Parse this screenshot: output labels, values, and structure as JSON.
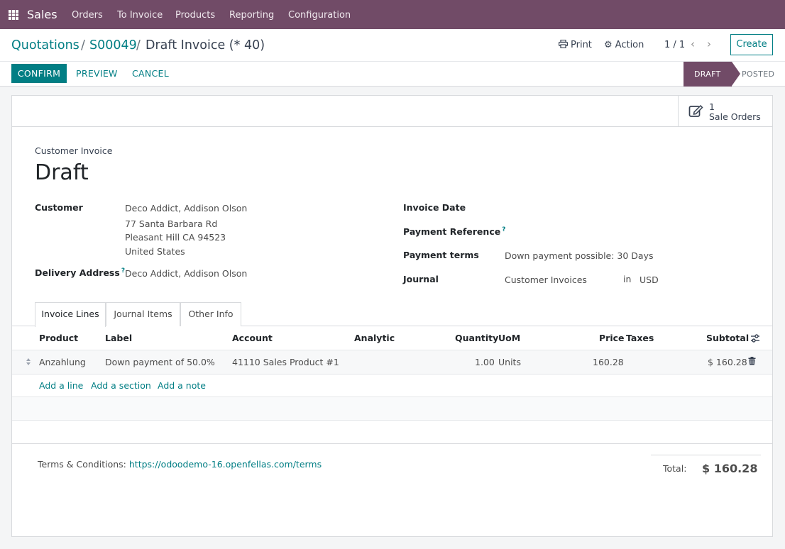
{
  "navbar": {
    "app_name": "Sales",
    "menu": [
      "Orders",
      "To Invoice",
      "Products",
      "Reporting",
      "Configuration"
    ]
  },
  "breadcrumb": {
    "items": [
      "Quotations",
      "S00049"
    ],
    "current": "Draft Invoice (* 40)",
    "separator": "/"
  },
  "control": {
    "print_label": "Print",
    "action_label": "Action",
    "pager": "1 / 1",
    "create_label": "Create"
  },
  "statusbar": {
    "buttons": [
      "CONFIRM",
      "PREVIEW",
      "CANCEL"
    ],
    "stages": [
      "DRAFT",
      "POSTED"
    ],
    "active_stage": "DRAFT"
  },
  "smart_button": {
    "count": "1",
    "label": "Sale Orders"
  },
  "document": {
    "type": "Customer Invoice",
    "title": "Draft"
  },
  "fields_left": {
    "customer_label": "Customer",
    "customer_lines": [
      "Deco Addict, Addison Olson",
      "77 Santa Barbara Rd",
      "Pleasant Hill CA 94523",
      "United States"
    ],
    "delivery_label": "Delivery Address",
    "delivery_value": "Deco Addict, Addison Olson"
  },
  "fields_right": {
    "invoice_date_label": "Invoice Date",
    "payment_reference_label": "Payment Reference",
    "payment_terms_label": "Payment terms",
    "payment_terms_value": "Down payment possible: 30 Days",
    "journal_label": "Journal",
    "journal_value": "Customer Invoices",
    "journal_in": "in",
    "currency": "USD"
  },
  "help_marker": "?",
  "tabs": [
    "Invoice Lines",
    "Journal Items",
    "Other Info"
  ],
  "table": {
    "headers": [
      "Product",
      "Label",
      "Account",
      "Analytic",
      "Quantity",
      "UoM",
      "Price",
      "Taxes",
      "Subtotal"
    ],
    "rows": [
      {
        "product": "Anzahlung",
        "label": "Down payment of 50.0%",
        "account": "41110 Sales Product #1",
        "analytic": "",
        "quantity": "1.00",
        "uom": "Units",
        "price": "160.28",
        "taxes": "",
        "subtotal": "$ 160.28"
      }
    ],
    "add_links": [
      "Add a line",
      "Add a section",
      "Add a note"
    ]
  },
  "footer": {
    "terms_label": "Terms & Conditions:",
    "terms_link": "https://odoodemo-16.openfellas.com/terms",
    "total_label": "Total:",
    "total_value": "$ 160.28"
  },
  "colors": {
    "brand": "#714b67",
    "accent": "#017e84"
  },
  "icons": [
    "apps-grid-icon",
    "print-icon",
    "gear-icon",
    "chevron-left-icon",
    "chevron-right-icon",
    "edit-icon",
    "drag-handle-icon",
    "column-settings-icon",
    "trash-icon"
  ]
}
